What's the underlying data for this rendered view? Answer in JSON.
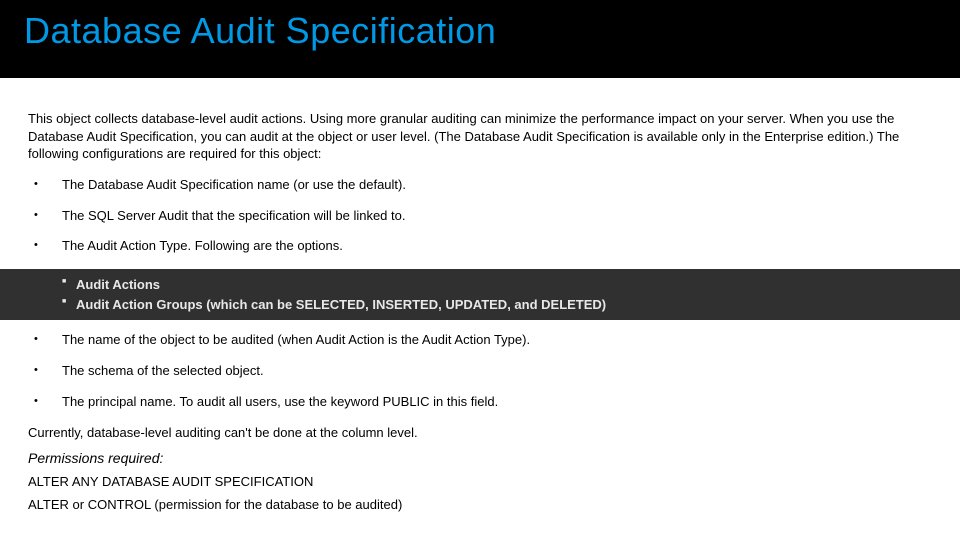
{
  "header": {
    "title": "Database Audit Specification"
  },
  "intro": "This object collects database-level audit actions. Using more granular auditing can minimize the performance impact on your server. When you use the Database Audit Specification, you can audit at the object or user level. (The Database Audit Specification is available only in the Enterprise edition.) The following configurations are required for this object:",
  "bullets_top": [
    "The Database Audit Specification name (or use the default).",
    "The SQL Server Audit that the specification will be linked to.",
    "The Audit Action Type. Following are the options."
  ],
  "sub_bullets": [
    "Audit Actions",
    "Audit Action Groups (which can be SELECTED, INSERTED, UPDATED, and DELETED)"
  ],
  "bullets_bottom": [
    "The name of the object to be audited (when Audit Action is the Audit Action Type).",
    "The schema of the selected object.",
    "The principal name. To audit all users, use the keyword PUBLIC in this field."
  ],
  "note": "Currently, database-level auditing can't be done at the column level.",
  "permissions_heading": "Permissions required:",
  "permissions": [
    "ALTER ANY DATABASE AUDIT SPECIFICATION",
    "ALTER or CONTROL (permission for the database to be audited)"
  ]
}
